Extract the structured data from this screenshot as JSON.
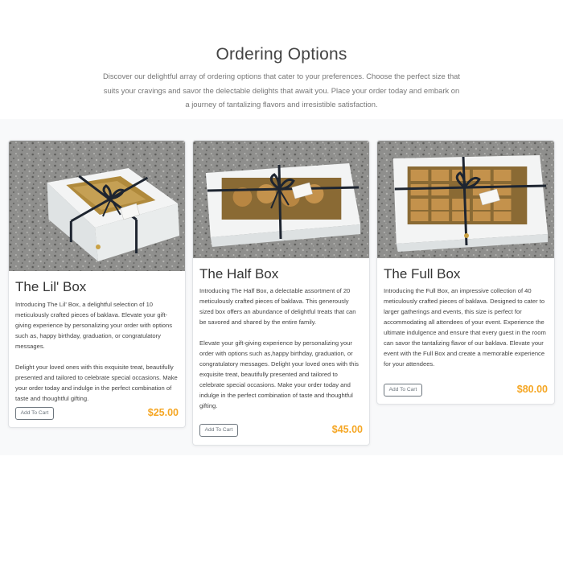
{
  "header": {
    "title": "Ordering Options",
    "subtitle": "Discover our delightful array of ordering options that cater to your preferences. Choose the perfect size that suits your cravings and savor the delectable delights that await you. Place your order today and embark on a journey of tantalizing flavors and irresistible satisfaction."
  },
  "products": [
    {
      "name": "The Lil' Box",
      "paragraphs": [
        "Introducing The Lil' Box, a delightful selection of 10 meticulously crafted pieces of baklava. Elevate your gift-giving experience by personalizing your order with options such as, happy birthday, graduation, or congratulatory messages.",
        "Delight your loved ones with this exquisite treat, beautifully presented and tailored to celebrate special occasions. Make your order today and indulge in the perfect combination of taste and thoughtful gifting."
      ],
      "button": "Add To Cart",
      "price": "$25.00"
    },
    {
      "name": "The Half Box",
      "paragraphs": [
        "Introducing The Half Box, a delectable assortment of 20 meticulously crafted pieces of baklava. This generously sized box offers an abundance of delightful treats that can be savored and shared by the entire family.",
        "Elevate your gift-giving experience by personalizing your order with options such as,happy birthday, graduation, or congratulatory messages. Delight your loved ones with this exquisite treat, beautifully presented and tailored to celebrate special occasions. Make your order today and indulge in the perfect combination of taste and thoughtful gifting."
      ],
      "button": "Add To Cart",
      "price": "$45.00"
    },
    {
      "name": "The Full Box",
      "paragraphs": [
        "Introducing the Full Box, an impressive collection of 40 meticulously crafted pieces of baklava. Designed to cater to larger gatherings and events, this size is perfect for accommodating all attendees of your event. Experience the ultimate indulgence and ensure that every guest in the room can savor the tantalizing flavor of our baklava. Elevate your event with the Full Box and create a memorable experience for your attendees."
      ],
      "button": "Add To Cart",
      "price": "$80.00"
    }
  ],
  "colors": {
    "price": "#f5a623",
    "band": "#f8f9fa",
    "ribbon": "#1e2530",
    "box": "#eef1f2",
    "baklava": "#b88642"
  }
}
